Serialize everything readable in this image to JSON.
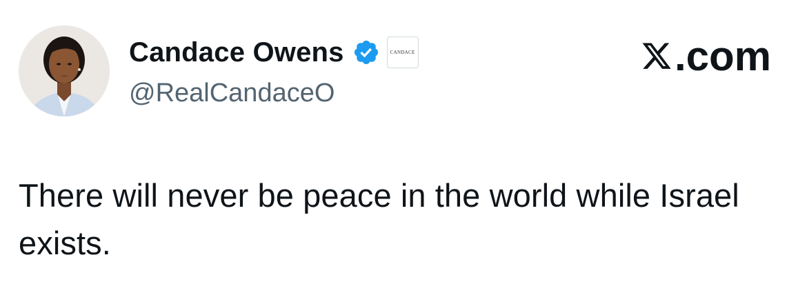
{
  "author": {
    "display_name": "Candace Owens",
    "handle": "@RealCandaceO",
    "affiliate_badge_text": "CANDACE",
    "verified_icon": "verified-badge-icon",
    "verified_color": "#1d9bf0"
  },
  "site": {
    "label": ".com",
    "logo_icon": "x-logo-icon"
  },
  "tweet": {
    "text": "There will never be peace in the world while Israel exists."
  },
  "colors": {
    "text_primary": "#0f1419",
    "text_secondary": "#536471",
    "background": "#ffffff"
  }
}
